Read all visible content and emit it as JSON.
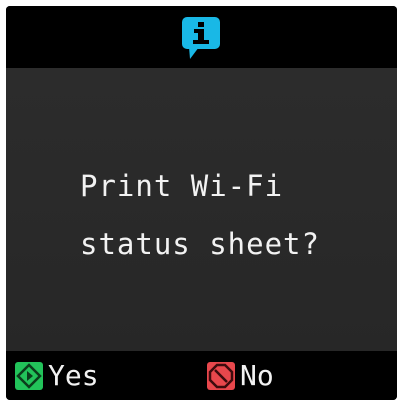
{
  "dialog": {
    "icon": "info-icon",
    "message_line1": "Print Wi-Fi",
    "message_line2": "status sheet?"
  },
  "softkeys": {
    "yes": {
      "icon": "start-diamond-icon",
      "label": "Yes",
      "color": "#22c35a"
    },
    "no": {
      "icon": "stop-octagon-icon",
      "label": "No",
      "color": "#e8474c"
    }
  },
  "colors": {
    "info_accent": "#19b8e6",
    "panel_background": "#2a2a2a",
    "bar_background": "#000000",
    "text": "#f2f2f2"
  }
}
